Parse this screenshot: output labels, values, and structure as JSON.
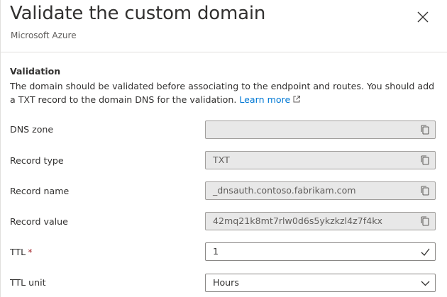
{
  "header": {
    "title": "Validate the custom domain",
    "subtitle": "Microsoft Azure"
  },
  "validation": {
    "heading": "Validation",
    "description": "The domain should be validated before associating to the endpoint and routes. You should add a TXT record to the domain DNS for the validation.",
    "learn_more": "Learn more"
  },
  "fields": {
    "dns_zone": {
      "label": "DNS zone",
      "value": ""
    },
    "record_type": {
      "label": "Record type",
      "value": "TXT"
    },
    "record_name": {
      "label": "Record name",
      "value": "_dnsauth.contoso.fabrikam.com"
    },
    "record_value": {
      "label": "Record value",
      "value": "42mq21k8mt7rlw0d6s5ykzkzl4z7f4kx"
    },
    "ttl": {
      "label": "TTL",
      "required_mark": "*",
      "value": "1"
    },
    "ttl_unit": {
      "label": "TTL unit",
      "value": "Hours"
    }
  },
  "icons": {
    "close": "close-icon",
    "copy": "copy-icon",
    "external_link": "external-link-icon",
    "checkmark": "checkmark-icon",
    "chevron_down": "chevron-down-icon"
  },
  "colors": {
    "link": "#0078d4",
    "required": "#a4262c",
    "readonly_bg": "#e8e8e8",
    "text": "#323130"
  }
}
